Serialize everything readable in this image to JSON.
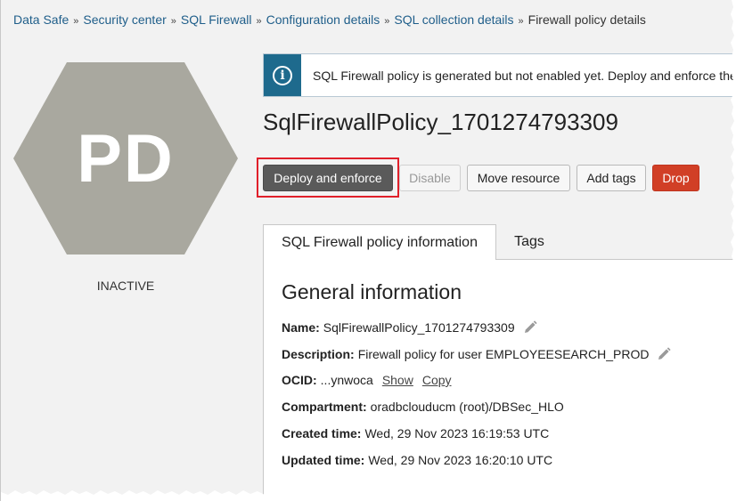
{
  "breadcrumb": {
    "items": [
      "Data Safe",
      "Security center",
      "SQL Firewall",
      "Configuration details",
      "SQL collection details"
    ],
    "current": "Firewall policy details",
    "separator": "»"
  },
  "avatar": {
    "initials": "PD",
    "status": "INACTIVE",
    "color": "#a9a89f"
  },
  "banner": {
    "icon": "info-icon",
    "text": "SQL Firewall policy is generated but not enabled yet. Deploy and enforce the"
  },
  "page_title": "SqlFirewallPolicy_1701274793309",
  "actions": {
    "deploy": "Deploy and enforce",
    "disable": "Disable",
    "move": "Move resource",
    "add_tags": "Add tags",
    "drop": "Drop"
  },
  "tabs": {
    "info": "SQL Firewall policy information",
    "tags": "Tags"
  },
  "general": {
    "heading": "General information",
    "name_label": "Name:",
    "name_value": "SqlFirewallPolicy_1701274793309",
    "description_label": "Description:",
    "description_value": "Firewall policy for user EMPLOYEESEARCH_PROD",
    "ocid_label": "OCID:",
    "ocid_value": "...ynwoca",
    "ocid_show": "Show",
    "ocid_copy": "Copy",
    "compartment_label": "Compartment:",
    "compartment_value": "oradbclouducm (root)/DBSec_HLO",
    "created_label": "Created time:",
    "created_value": "Wed, 29 Nov 2023 16:19:53 UTC",
    "updated_label": "Updated time:",
    "updated_value": "Wed, 29 Nov 2023 16:20:10 UTC"
  },
  "colors": {
    "link": "#1f5e8a",
    "banner_icon_bg": "#1e6a8d",
    "primary_button": "#5a5a5a",
    "danger_button": "#d13f26",
    "highlight": "#e0202a"
  }
}
